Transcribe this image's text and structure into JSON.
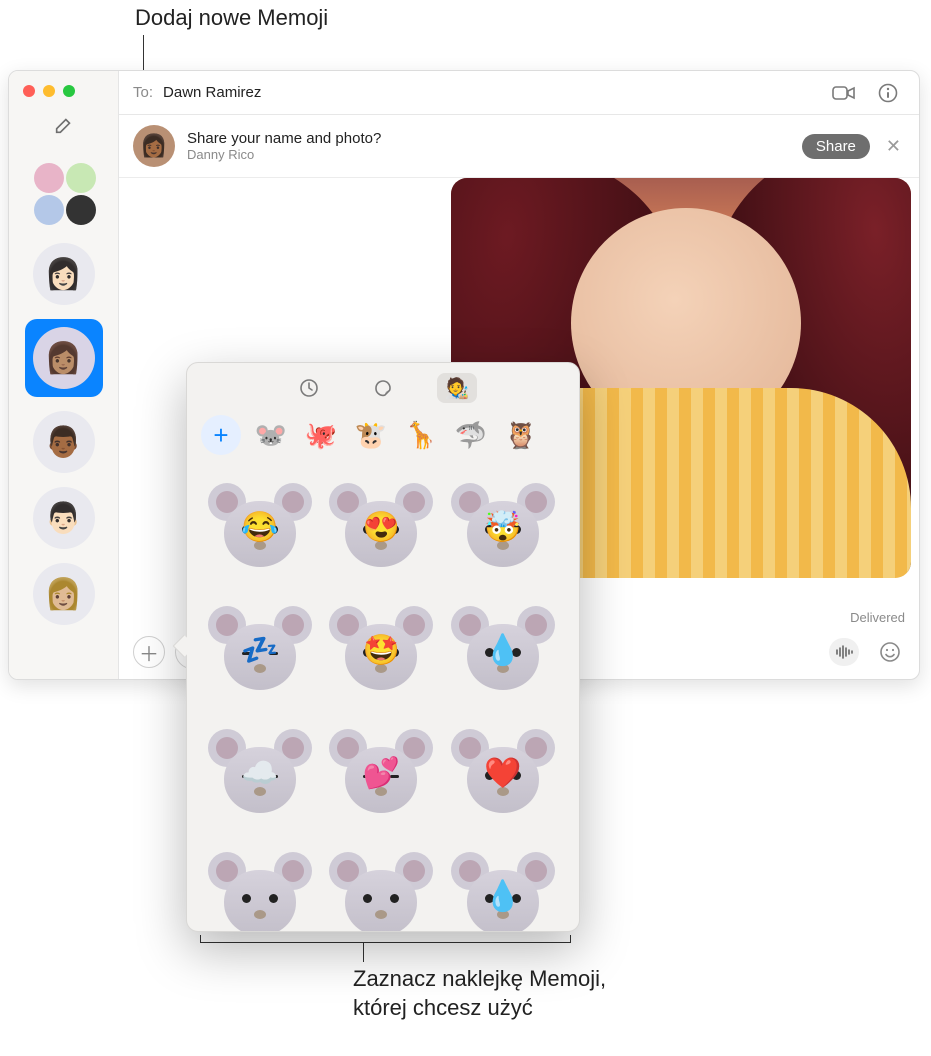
{
  "callouts": {
    "top": "Dodaj nowe Memoji",
    "bottom": "Zaznacz naklejkę Memoji,\nktórej chcesz użyć"
  },
  "header": {
    "to_label": "To:",
    "to_name": "Dawn Ramirez"
  },
  "banner": {
    "title": "Share your name and photo?",
    "subtitle": "Danny Rico",
    "share_label": "Share"
  },
  "thread": {
    "delivered_label": "Delivered"
  },
  "composer": {
    "placeholder": ""
  },
  "sidebar": {
    "conversations": [
      {
        "type": "group"
      },
      {
        "type": "single",
        "emoji": "👩🏻"
      },
      {
        "type": "single",
        "emoji": "👩🏽",
        "selected": true
      },
      {
        "type": "single",
        "emoji": "👨🏾"
      },
      {
        "type": "single",
        "emoji": "👨🏻"
      },
      {
        "type": "single",
        "emoji": "👩🏼"
      }
    ]
  },
  "popover": {
    "tabs": [
      {
        "name": "recent",
        "icon": "clock",
        "active": false
      },
      {
        "name": "stickers",
        "icon": "sticker",
        "active": false
      },
      {
        "name": "memoji",
        "icon": "memoji",
        "active": true
      }
    ],
    "add_label": "+",
    "characters": [
      {
        "name": "mouse",
        "emoji": "🐭"
      },
      {
        "name": "octopus",
        "emoji": "🐙"
      },
      {
        "name": "cow",
        "emoji": "🐮"
      },
      {
        "name": "giraffe",
        "emoji": "🦒"
      },
      {
        "name": "shark",
        "emoji": "🦈"
      },
      {
        "name": "owl",
        "emoji": "🦉"
      }
    ],
    "stickers": [
      {
        "id": "mouse-joy",
        "overlay": "😂",
        "closed_eyes": false
      },
      {
        "id": "mouse-heart-eyes",
        "overlay": "😍",
        "closed_eyes": false
      },
      {
        "id": "mouse-mind-blown",
        "overlay": "🤯",
        "closed_eyes": false
      },
      {
        "id": "mouse-sleeping",
        "overlay": "💤",
        "closed_eyes": true
      },
      {
        "id": "mouse-starstruck",
        "overlay": "🤩",
        "closed_eyes": false
      },
      {
        "id": "mouse-tear",
        "overlay": "💧",
        "closed_eyes": false
      },
      {
        "id": "mouse-cloud",
        "overlay": "☁️",
        "closed_eyes": true
      },
      {
        "id": "mouse-kisses",
        "overlay": "💕",
        "closed_eyes": true
      },
      {
        "id": "mouse-in-love",
        "overlay": "❤️",
        "closed_eyes": false
      },
      {
        "id": "mouse-worried",
        "overlay": "",
        "closed_eyes": false
      },
      {
        "id": "mouse-angry",
        "overlay": "",
        "closed_eyes": false
      },
      {
        "id": "mouse-sweat",
        "overlay": "💧",
        "closed_eyes": false
      }
    ]
  },
  "colors": {
    "accent": "#0a84ff",
    "sidebar_bg": "#f7f6f4",
    "popover_bg": "#f3f2f0"
  }
}
